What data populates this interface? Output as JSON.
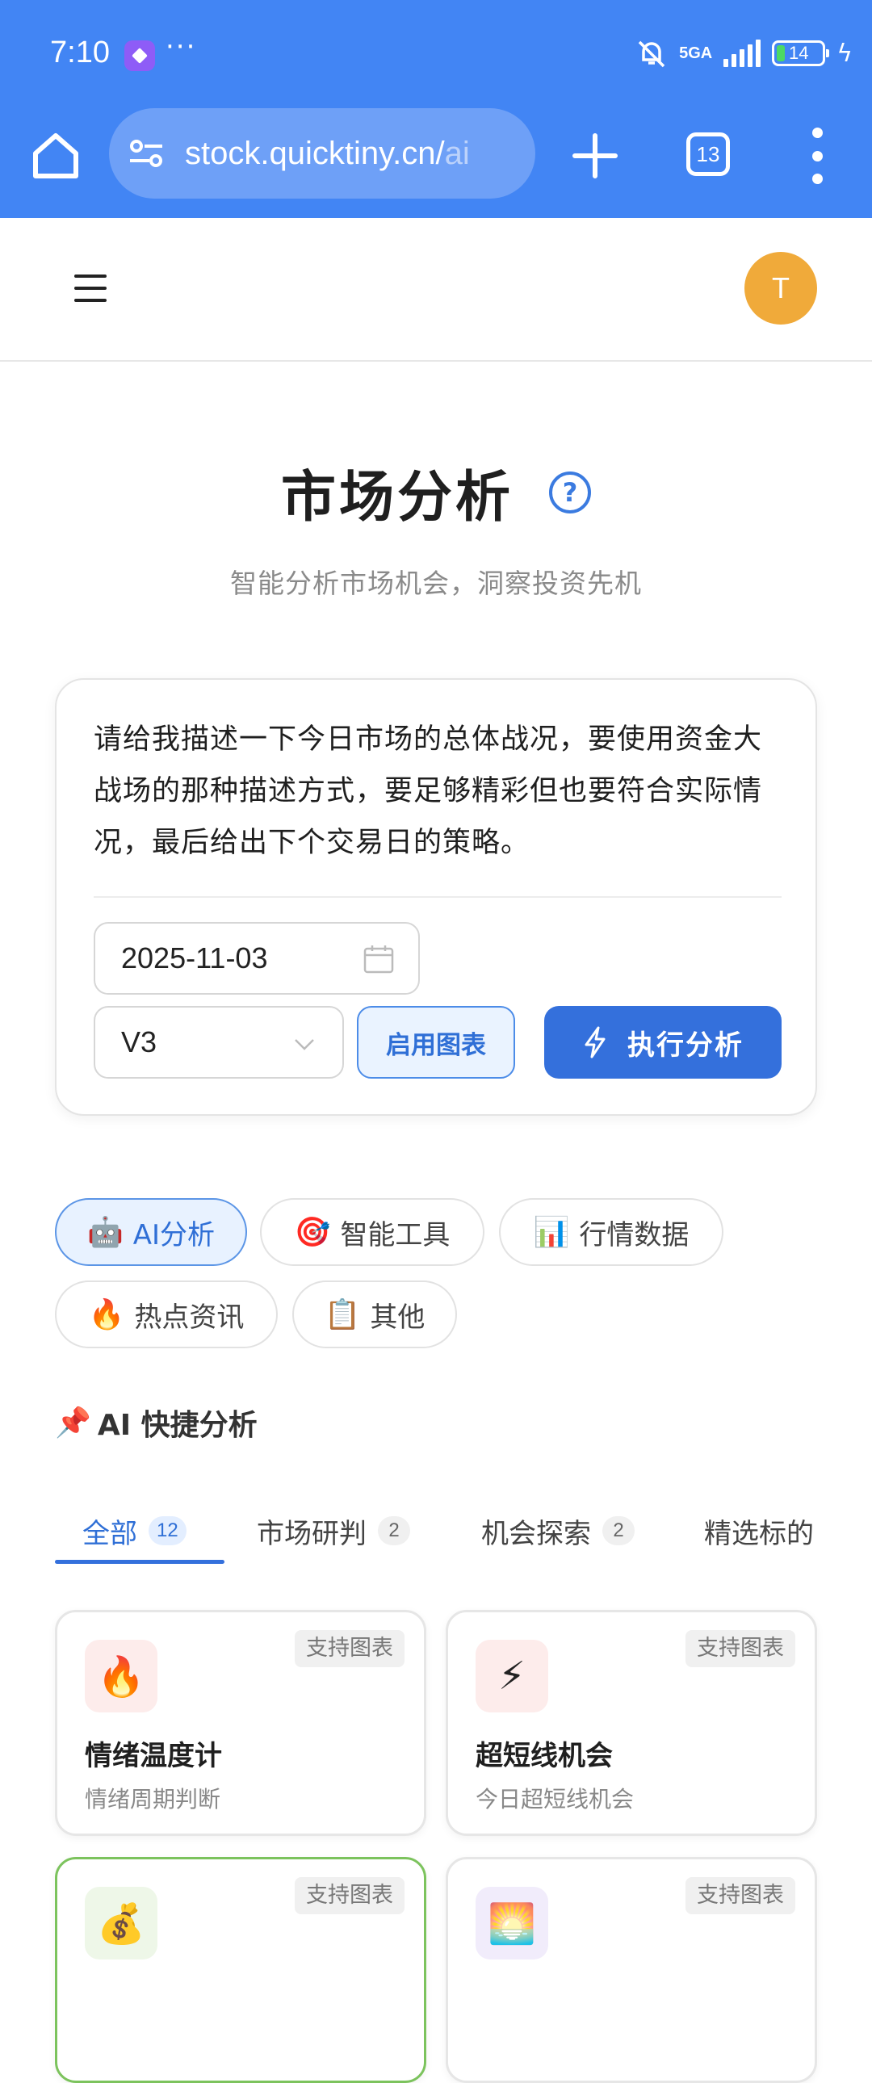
{
  "status_bar": {
    "time": "7:10",
    "overflow_dots": "···",
    "network": "5GA",
    "battery_level": "14",
    "charging": true
  },
  "browser": {
    "url_host": "stock.quicktiny.cn/",
    "url_path": "ai",
    "tab_count": "13"
  },
  "header": {
    "avatar_initial": "T"
  },
  "page": {
    "title": "市场分析",
    "subtitle": "智能分析市场机会，洞察投资先机"
  },
  "analysis_form": {
    "prompt_text": "请给我描述一下今日市场的总体战况，要使用资金大战场的那种描述方式，要足够精彩但也要符合实际情况，最后给出下个交易日的策略。",
    "date_value": "2025-11-03",
    "model_value": "V3",
    "chart_toggle_label": "启用图表",
    "run_button_label": "执行分析"
  },
  "category_chips": [
    {
      "emoji": "🤖",
      "label": "AI分析",
      "active": true
    },
    {
      "emoji": "🎯",
      "label": "智能工具",
      "active": false
    },
    {
      "emoji": "📊",
      "label": "行情数据",
      "active": false
    },
    {
      "emoji": "🔥",
      "label": "热点资讯",
      "active": false
    },
    {
      "emoji": "📋",
      "label": "其他",
      "active": false
    }
  ],
  "quick_section": {
    "emoji": "📌",
    "title": "AI 快捷分析"
  },
  "quick_tabs": [
    {
      "label": "全部",
      "count": "12",
      "active": true
    },
    {
      "label": "市场研判",
      "count": "2",
      "active": false
    },
    {
      "label": "机会探索",
      "count": "2",
      "active": false
    },
    {
      "label": "精选标的",
      "count": "",
      "active": false
    }
  ],
  "quick_cards": [
    {
      "icon": "🔥",
      "icon_bg": "#fdeceb",
      "badge": "支持图表",
      "name": "情绪温度计",
      "desc": "情绪周期判断"
    },
    {
      "icon": "⚡",
      "icon_bg": "#fdeceb",
      "badge": "支持图表",
      "name": "超短线机会",
      "desc": "今日超短线机会"
    },
    {
      "icon": "💰",
      "icon_bg": "#eef7e8",
      "badge": "支持图表",
      "name": "",
      "desc": ""
    },
    {
      "icon": "🌅",
      "icon_bg": "#f1ecfb",
      "badge": "支持图表",
      "name": "",
      "desc": ""
    }
  ],
  "colors": {
    "chrome_blue": "#4285f4",
    "primary": "#3470dc",
    "avatar": "#f0aa3a"
  }
}
